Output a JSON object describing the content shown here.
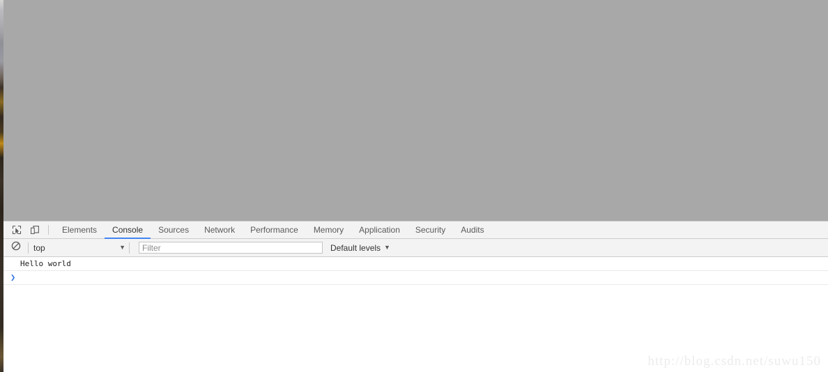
{
  "viewport": {
    "background_color": "#a8a8a8",
    "content": ""
  },
  "devtools": {
    "toolbar_icons": [
      {
        "name": "inspect-element-icon",
        "title": "Select an element in the page to inspect it"
      },
      {
        "name": "device-toolbar-icon",
        "title": "Toggle device toolbar"
      }
    ],
    "tabs": [
      {
        "label": "Elements",
        "active": false
      },
      {
        "label": "Console",
        "active": true
      },
      {
        "label": "Sources",
        "active": false
      },
      {
        "label": "Network",
        "active": false
      },
      {
        "label": "Performance",
        "active": false
      },
      {
        "label": "Memory",
        "active": false
      },
      {
        "label": "Application",
        "active": false
      },
      {
        "label": "Security",
        "active": false
      },
      {
        "label": "Audits",
        "active": false
      }
    ],
    "active_tab_accent": "#4285f4",
    "console": {
      "clear_button": {
        "name": "clear-console-icon",
        "title": "Clear console"
      },
      "context": {
        "value": "top",
        "caret": "▼"
      },
      "filter": {
        "placeholder": "Filter",
        "value": ""
      },
      "levels": {
        "label": "Default levels",
        "caret": "▼"
      },
      "messages": [
        {
          "text": "Hello world",
          "level": "log"
        }
      ],
      "prompt": {
        "arrow": "❯",
        "value": "",
        "arrow_color": "#2d6fe0"
      }
    }
  },
  "watermark": {
    "text": "http://blog.csdn.net/suwu150"
  }
}
